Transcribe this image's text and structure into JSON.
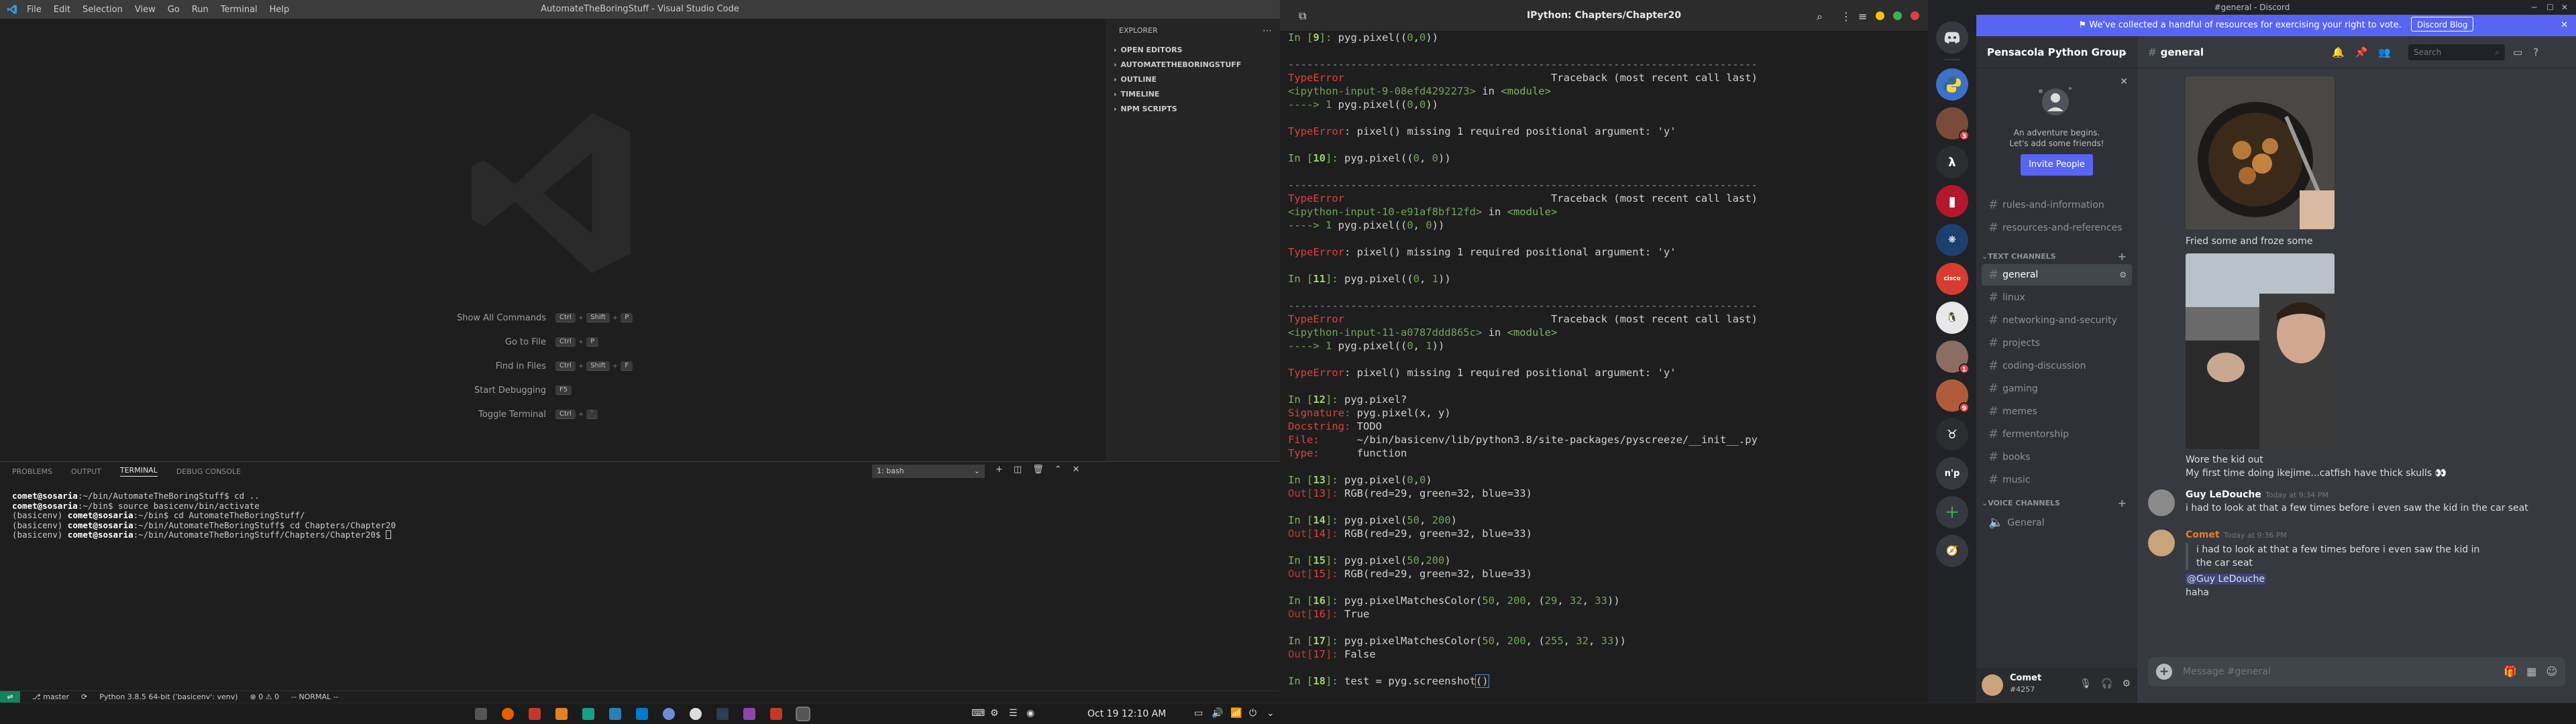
{
  "vscode": {
    "menu": [
      "File",
      "Edit",
      "Selection",
      "View",
      "Go",
      "Run",
      "Terminal",
      "Help"
    ],
    "title": "AutomateTheBoringStuff - Visual Studio Code",
    "shortcuts": [
      {
        "label": "Show All Commands",
        "keys": [
          "Ctrl",
          "+",
          "Shift",
          "+",
          "P"
        ]
      },
      {
        "label": "Go to File",
        "keys": [
          "Ctrl",
          "+",
          "P"
        ]
      },
      {
        "label": "Find in Files",
        "keys": [
          "Ctrl",
          "+",
          "Shift",
          "+",
          "F"
        ]
      },
      {
        "label": "Start Debugging",
        "keys": [
          "F5"
        ]
      },
      {
        "label": "Toggle Terminal",
        "keys": [
          "Ctrl",
          "+",
          "`"
        ]
      }
    ],
    "explorer": {
      "header": "EXPLORER",
      "sections": [
        "OPEN EDITORS",
        "AUTOMATETHEBORINGSTUFF",
        "OUTLINE",
        "TIMELINE",
        "NPM SCRIPTS"
      ]
    },
    "panel": {
      "tabs": [
        "PROBLEMS",
        "OUTPUT",
        "TERMINAL",
        "DEBUG CONSOLE"
      ],
      "terminal_select": "1: bash",
      "lines": [
        {
          "user": "comet@sosaria",
          "rest": ":~/bin/AutomateTheBoringStuff$ cd ..",
          "prefix": ""
        },
        {
          "user": "comet@sosaria",
          "rest": ":~/bin$ source basicenv/bin/activate",
          "prefix": ""
        },
        {
          "user": "comet@sosaria",
          "rest": ":~/bin$ cd AutomateTheBoringStuff/",
          "prefix": "(basicenv) "
        },
        {
          "user": "comet@sosaria",
          "rest": ":~/bin/AutomateTheBoringStuff$ cd Chapters/Chapter20",
          "prefix": "(basicenv) "
        },
        {
          "user": "comet@sosaria",
          "rest": ":~/bin/AutomateTheBoringStuff/Chapters/Chapter20$ ",
          "prefix": "(basicenv) "
        }
      ]
    },
    "status": {
      "branch": "master",
      "python": "Python 3.8.5 64-bit ('basicenv': venv)",
      "problems": "⊗ 0  ⚠ 0",
      "mode": "-- NORMAL --"
    }
  },
  "ipython": {
    "title": "IPython: Chapters/Chapter20"
  },
  "discord": {
    "window_title": "#general - Discord",
    "notice": "We've collected a handful of resources for exercising your right to vote.",
    "notice_button": "Discord Blog",
    "server_name": "Pensacola Python Group",
    "invite_text_1": "An adventure begins.",
    "invite_text_2": "Let's add some friends!",
    "invite_button": "Invite People",
    "top_channels": [
      "rules-and-information",
      "resources-and-references"
    ],
    "text_category": "TEXT CHANNELS",
    "text_channels": [
      "general",
      "linux",
      "networking-and-security",
      "projects",
      "coding-discussion",
      "gaming",
      "memes",
      "fermentorship",
      "books",
      "music"
    ],
    "voice_category": "VOICE CHANNELS",
    "voice_channels": [
      "General"
    ],
    "user": {
      "name": "Comet",
      "tag": "#4257"
    },
    "channel_header": "general",
    "search_placeholder": "Search",
    "messages": {
      "caption1": "Fried some and froze some",
      "caption2": "Wore the kid out",
      "caption3": "My first time doing ikejime...catfish have thick skulls 👀",
      "m1_author": "Guy LeDouche",
      "m1_time": "Today at 9:34 PM",
      "m1_text": "i had to look at that a few times before i even saw the kid in the car seat",
      "m2_author": "Comet",
      "m2_time": "Today at 9:36 PM",
      "m2_quote": "i had to look at that a few times before i even saw the kid in the car seat",
      "m2_mention": "@Guy LeDouche",
      "m2_text": "haha"
    },
    "composer_placeholder": "Message #general"
  },
  "taskbar": {
    "clock": "Oct 19  12:10 AM"
  },
  "colors": {
    "vscode_bg": "#1e1e1e",
    "discord_bg": "#36393f",
    "discord_blurple": "#5865f2",
    "ipython_error": "#e0413b",
    "ipython_prompt": "#7bb661"
  }
}
